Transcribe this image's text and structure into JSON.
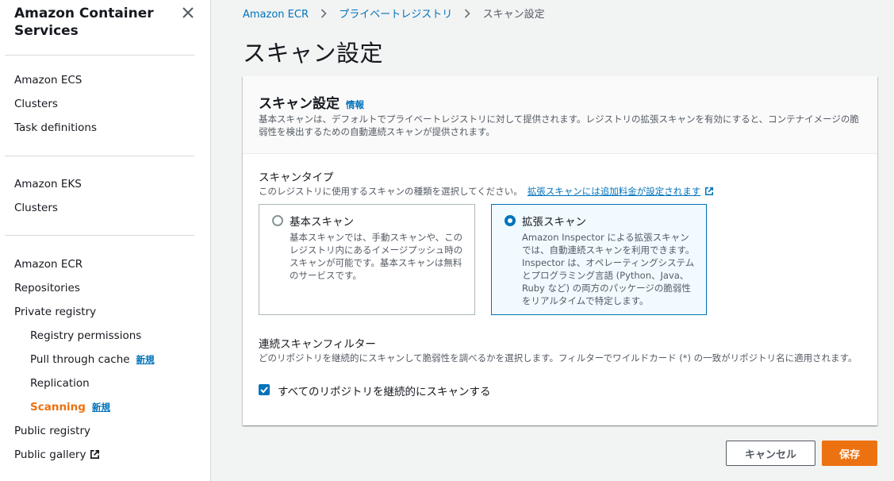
{
  "sidebar": {
    "title": "Amazon Container Services",
    "sections": [
      {
        "header": "Amazon ECS",
        "items": [
          "Clusters",
          "Task definitions"
        ]
      },
      {
        "header": "Amazon EKS",
        "items": [
          "Clusters"
        ]
      }
    ],
    "ecr": {
      "header": "Amazon ECR",
      "repositories": "Repositories",
      "private_registry": "Private registry",
      "registry_permissions": "Registry permissions",
      "pull_through_cache": "Pull through cache",
      "replication": "Replication",
      "scanning": "Scanning",
      "public_registry": "Public registry",
      "public_gallery": "Public gallery"
    },
    "new_badge": "新規",
    "active_color": "#ec7211"
  },
  "breadcrumb": [
    "Amazon ECR",
    "プライベートレジストリ",
    "スキャン設定"
  ],
  "page_title": "スキャン設定",
  "panel": {
    "title": "スキャン設定",
    "info": "情報",
    "description": "基本スキャンは、デフォルトでプライベートレジストリに対して提供されます。レジストリの拡張スキャンを有効にすると、コンテナイメージの脆弱性を検出するための自動連続スキャンが提供されます。",
    "scan_type": {
      "label": "スキャンタイプ",
      "description": "このレジストリに使用するスキャンの種類を選択してください。",
      "link": "拡張スキャンには追加料金が設定されます",
      "options": [
        {
          "title": "基本スキャン",
          "description": "基本スキャンでは、手動スキャンや、このレジストリ内にあるイメージプッシュ時のスキャンが可能です。基本スキャンは無料のサービスです。",
          "selected": false
        },
        {
          "title": "拡張スキャン",
          "description": "Amazon Inspector による拡張スキャンでは、自動連続スキャンを利用できます。Inspector は、オペレーティングシステムとプログラミング言語 (Python、Java、Ruby など) の両方のパッケージの脆弱性をリアルタイムで特定します。",
          "selected": true
        }
      ]
    },
    "filter": {
      "label": "連続スキャンフィルター",
      "description": "どのリポジトリを継続的にスキャンして脆弱性を調べるかを選択します。フィルターでワイルドカード (*) の一致がリポジトリ名に適用されます。",
      "checkbox_label": "すべてのリポジトリを継続的にスキャンする",
      "checked": true
    }
  },
  "buttons": {
    "cancel": "キャンセル",
    "save": "保存"
  },
  "colors": {
    "accent": "#ec7211",
    "link": "#0073bb"
  }
}
